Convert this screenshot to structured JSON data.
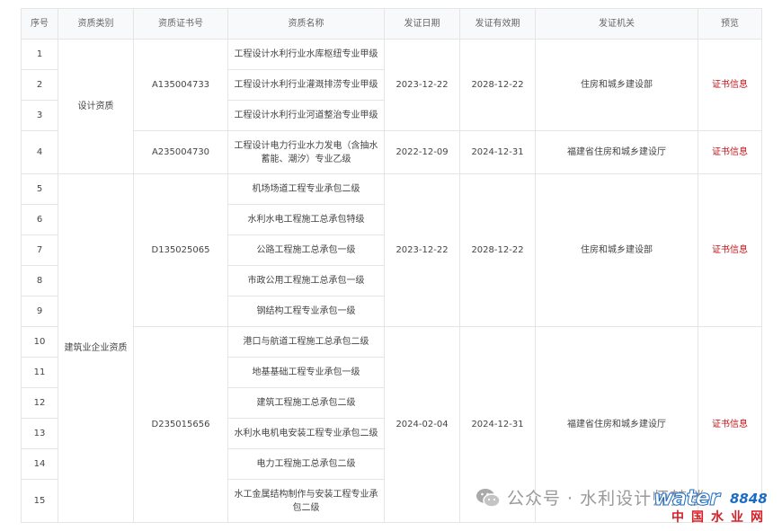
{
  "headers": [
    "序号",
    "资质类别",
    "资质证书号",
    "资质名称",
    "发证日期",
    "发证有效期",
    "发证机关",
    "预览"
  ],
  "rows": [
    {
      "no": "1",
      "name": "工程设计水利行业水库枢纽专业甲级"
    },
    {
      "no": "2",
      "name": "工程设计水利行业灌溉排涝专业甲级"
    },
    {
      "no": "3",
      "name": "工程设计水利行业河道整治专业甲级"
    },
    {
      "no": "4",
      "name": "工程设计电力行业水力发电（含抽水蓄能、潮汐）专业乙级"
    },
    {
      "no": "5",
      "name": "机场场道工程专业承包二级"
    },
    {
      "no": "6",
      "name": "水利水电工程施工总承包特级"
    },
    {
      "no": "7",
      "name": "公路工程施工总承包一级"
    },
    {
      "no": "8",
      "name": "市政公用工程施工总承包一级"
    },
    {
      "no": "9",
      "name": "钢结构工程专业承包一级"
    },
    {
      "no": "10",
      "name": "港口与航道工程施工总承包二级"
    },
    {
      "no": "11",
      "name": "地基基础工程专业承包一级"
    },
    {
      "no": "12",
      "name": "建筑工程施工总承包二级"
    },
    {
      "no": "13",
      "name": "水利水电机电安装工程专业承包二级"
    },
    {
      "no": "14",
      "name": "电力工程施工总承包二级"
    },
    {
      "no": "15",
      "name": "水工金属结构制作与安装工程专业承包二级"
    }
  ],
  "categories": [
    "设计资质",
    "建筑业企业资质"
  ],
  "groups": [
    {
      "cert_no": "A135004733",
      "issue_date": "2023-12-22",
      "valid_until": "2028-12-22",
      "authority": "住房和城乡建设部",
      "preview": "证书信息"
    },
    {
      "cert_no": "A235004730",
      "issue_date": "2022-12-09",
      "valid_until": "2024-12-31",
      "authority": "福建省住房和城乡建设厅",
      "preview": "证书信息"
    },
    {
      "cert_no": "D135025065",
      "issue_date": "2023-12-22",
      "valid_until": "2028-12-22",
      "authority": "住房和城乡建设部",
      "preview": "证书信息"
    },
    {
      "cert_no": "D235015656",
      "issue_date": "2024-02-04",
      "valid_until": "2024-12-31",
      "authority": "福建省住房和城乡建设厅",
      "preview": "证书信息"
    }
  ],
  "watermark": {
    "text": "公众号 · 水利设计师梦楼",
    "icon": "wechat-icon"
  },
  "logo": {
    "word": "water",
    "num": "8848",
    "cn": "中国水业网",
    "colors": {
      "blue": "#1a6bc4",
      "red": "#d71f26"
    }
  },
  "colors": {
    "link": "#c0161b",
    "border": "#e5e5e5",
    "header_bg": "#f8f9fb"
  }
}
